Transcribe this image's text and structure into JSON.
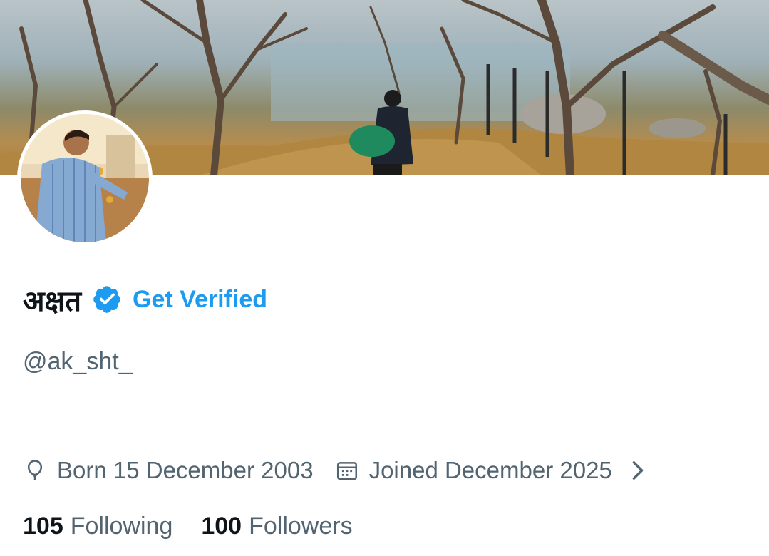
{
  "profile": {
    "display_name": "अक्षत",
    "verified_badge_icon": "verified-badge-icon",
    "get_verified_label": "Get Verified",
    "handle": "@ak_sht_",
    "born": "Born 15 December 2003",
    "joined": "Joined December 2025",
    "following_count": "105",
    "following_label": "Following",
    "followers_count": "100",
    "followers_label": "Followers"
  },
  "icons": {
    "birthday": "balloon-icon",
    "joined": "calendar-icon",
    "more": "chevron-right-icon"
  },
  "colors": {
    "accent": "#1d9bf0",
    "text_primary": "#0f1419",
    "text_secondary": "#536471"
  }
}
